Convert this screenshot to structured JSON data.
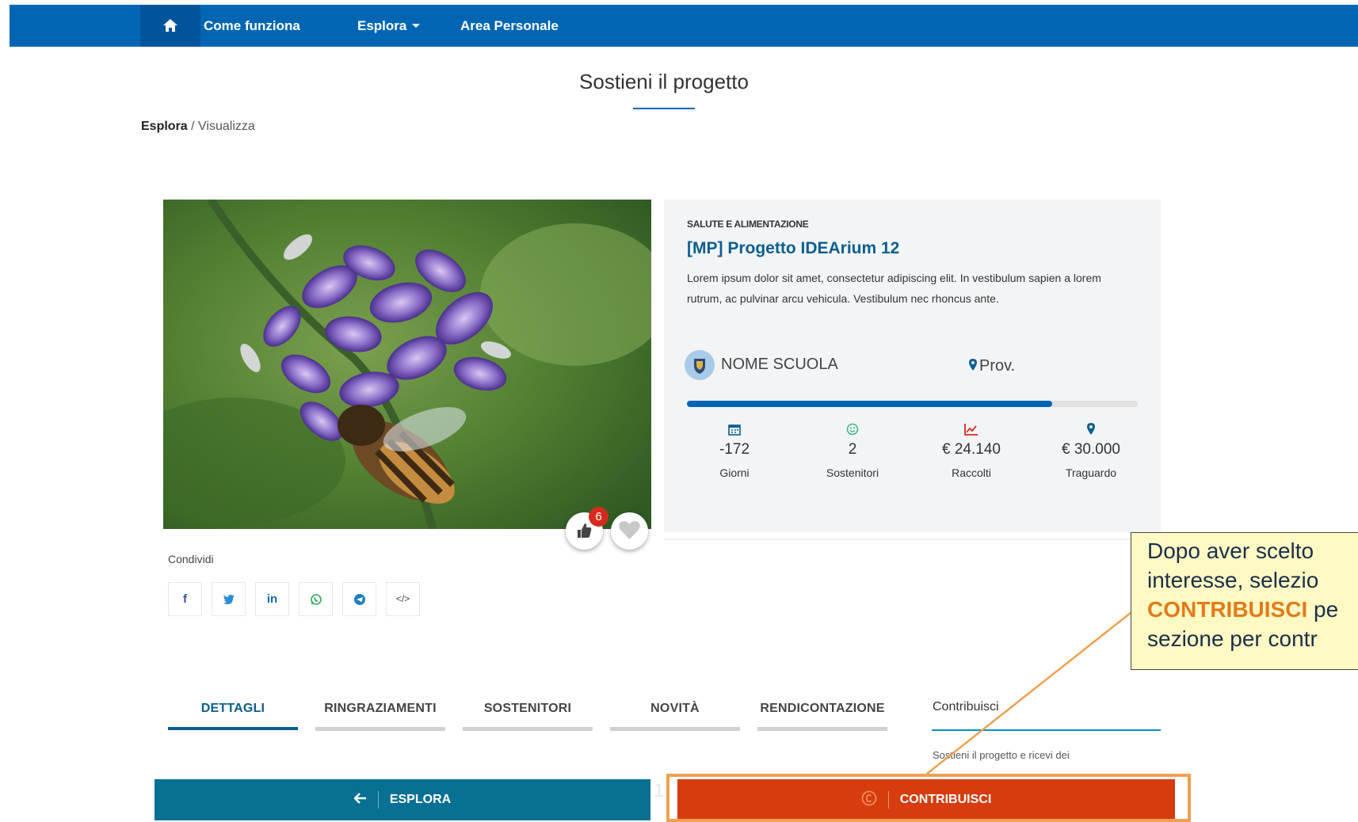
{
  "nav": {
    "home_icon": "home-icon",
    "items": [
      {
        "label": "Come funziona"
      },
      {
        "label": "Esplora"
      },
      {
        "label": "Area Personale"
      }
    ]
  },
  "page": {
    "title": "Sostieni il progetto",
    "breadcrumb": {
      "root": "Esplora",
      "separator": " / ",
      "current": "Visualizza"
    }
  },
  "project": {
    "category": "SALUTE E ALIMENTAZIONE",
    "title": "[MP] Progetto IDEArium 12",
    "description": "Lorem ipsum dolor sit amet, consectetur adipiscing elit. In vestibulum sapien a lorem rutrum, ac pulvinar arcu vehicula. Vestibulum nec rhoncus ante.",
    "school_name": "NOME SCUOLA",
    "province": "Prov.",
    "progress_fraction": 0.81,
    "likes": "6",
    "stats": [
      {
        "icon": "calendar-icon",
        "value": "-172",
        "label": "Giorni"
      },
      {
        "icon": "smiley-icon",
        "value": "2",
        "label": "Sostenitori"
      },
      {
        "icon": "chart-icon",
        "value": "€ 24.140",
        "label": "Raccolti"
      },
      {
        "icon": "map-marker-icon",
        "value": "€ 30.000",
        "label": "Traguardo"
      }
    ]
  },
  "share": {
    "label": "Condividi",
    "buttons": [
      {
        "icon": "facebook-icon",
        "text": "f"
      },
      {
        "icon": "twitter-icon",
        "text": ""
      },
      {
        "icon": "linkedin-icon",
        "text": "in"
      },
      {
        "icon": "whatsapp-icon",
        "text": ""
      },
      {
        "icon": "telegram-icon",
        "text": ""
      },
      {
        "icon": "embed-code-icon",
        "text": "</>"
      }
    ]
  },
  "tabs": [
    {
      "label": "DETTAGLI",
      "active": true
    },
    {
      "label": "RINGRAZIAMENTI",
      "active": false
    },
    {
      "label": "SOSTENITORI",
      "active": false
    },
    {
      "label": "NOVITÀ",
      "active": false
    },
    {
      "label": "RENDICONTAZIONE",
      "active": false
    }
  ],
  "contribute_panel": {
    "title": "Contribuisci",
    "text": "Sostieni il progetto e ricevi dei ringraziamenti speciali."
  },
  "bottom_bar": {
    "explore_label": "ESPLORA",
    "contribute_label": "CONTRIBUISCI",
    "ghost_text": "1"
  },
  "callout": {
    "line1": "Dopo aver scelto",
    "line2": "interesse, selezio",
    "keyword": "CONTRIBUISCI",
    "line3_rest": " pe",
    "line4": "sezione per contr"
  },
  "colors": {
    "nav_bg": "#0066b3",
    "accent_blue": "#0a5e8e",
    "contribute_orange": "#d63c0e",
    "explore_teal": "#077093",
    "callout_bg": "#fff9c4",
    "highlight_orange": "#f0a050"
  }
}
